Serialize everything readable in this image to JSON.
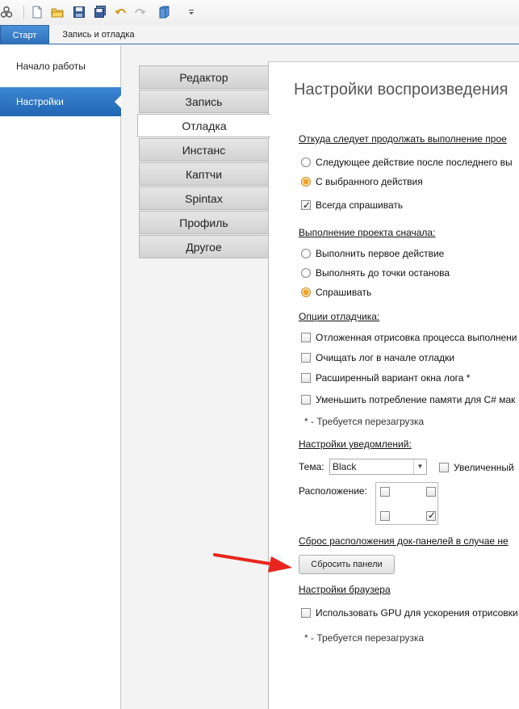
{
  "toolbar": {
    "icons": [
      "logo-icon",
      "new-file-icon",
      "open-folder-icon",
      "save-icon",
      "save-all-icon",
      "undo-icon",
      "redo-icon",
      "box-icon",
      "customize-dropdown-icon"
    ]
  },
  "ribbon": {
    "tabs": [
      {
        "label": "Старт",
        "active": true
      },
      {
        "label": "Запись и отладка",
        "active": false
      }
    ]
  },
  "nav": {
    "items": [
      {
        "label": "Начало работы",
        "selected": false
      },
      {
        "label": "Настройки",
        "selected": true
      }
    ]
  },
  "categories": [
    {
      "label": "Редактор",
      "active": false
    },
    {
      "label": "Запись",
      "active": false
    },
    {
      "label": "Отладка",
      "active": true
    },
    {
      "label": "Инстанс",
      "active": false
    },
    {
      "label": "Каптчи",
      "active": false
    },
    {
      "label": "Spintax",
      "active": false
    },
    {
      "label": "Профиль",
      "active": false
    },
    {
      "label": "Другое",
      "active": false
    }
  ],
  "content": {
    "title": "Настройки воспроизведения",
    "continue_section": {
      "heading": "Откуда следует продолжать выполнение прое",
      "options": [
        {
          "label": "Следующее действие после последнего вы",
          "selected": false
        },
        {
          "label": "С выбранного действия",
          "selected": true
        }
      ],
      "always_ask": {
        "label": "Всегда спрашивать",
        "checked": true
      }
    },
    "restart_section": {
      "heading": "Выполнение проекта сначала:",
      "options": [
        {
          "label": "Выполнить первое действие",
          "selected": false
        },
        {
          "label": "Выполнять до точки останова",
          "selected": false
        },
        {
          "label": "Спрашивать",
          "selected": true
        }
      ]
    },
    "debugger_section": {
      "heading": "Опции отладчика:",
      "options": [
        {
          "label": "Отложенная отрисовка процесса выполнени",
          "checked": false
        },
        {
          "label": "Очищать лог в начале отладки",
          "checked": false
        },
        {
          "label": "Расширенный вариант окна лога *",
          "checked": false
        },
        {
          "label": "Уменьшить потребление памяти для C# мак",
          "checked": false
        }
      ],
      "note": "* - Требуется перезагрузка"
    },
    "notifications_section": {
      "heading": "Настройки уведомлений:",
      "theme_label": "Тема:",
      "theme_value": "Black",
      "enlarged_label": "Увеличенный",
      "enlarged_checked": false,
      "position_label": "Расположение:",
      "positions": [
        {
          "name": "top-left",
          "checked": false
        },
        {
          "name": "top-right",
          "checked": false
        },
        {
          "name": "bottom-left",
          "checked": false
        },
        {
          "name": "bottom-right",
          "checked": true
        }
      ]
    },
    "reset_section": {
      "heading": "Сброс расположения док-панелей в случае не",
      "button_label": "Сбросить панели"
    },
    "browser_section": {
      "heading": "Настройки браузера",
      "gpu": {
        "label": "Использовать GPU для ускорения отрисовки",
        "checked": false
      },
      "note": "* - Требуется перезагрузка"
    }
  },
  "annotation": {
    "color": "#e8261d",
    "target": "reset-panels-button"
  }
}
